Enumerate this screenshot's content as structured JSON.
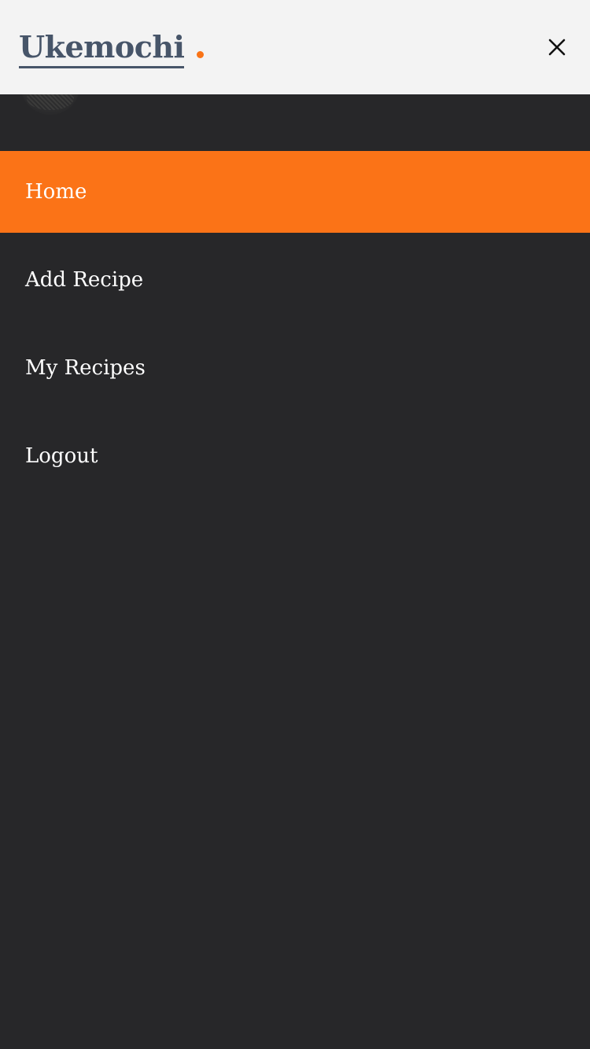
{
  "header": {
    "brand": "Ukemochi",
    "accent_color": "#f97316",
    "close_icon": "close-icon"
  },
  "menu": {
    "items": [
      {
        "label": "Home",
        "active": true
      },
      {
        "label": "Add Recipe",
        "active": false
      },
      {
        "label": "My Recipes",
        "active": false
      },
      {
        "label": "Logout",
        "active": false
      }
    ]
  }
}
